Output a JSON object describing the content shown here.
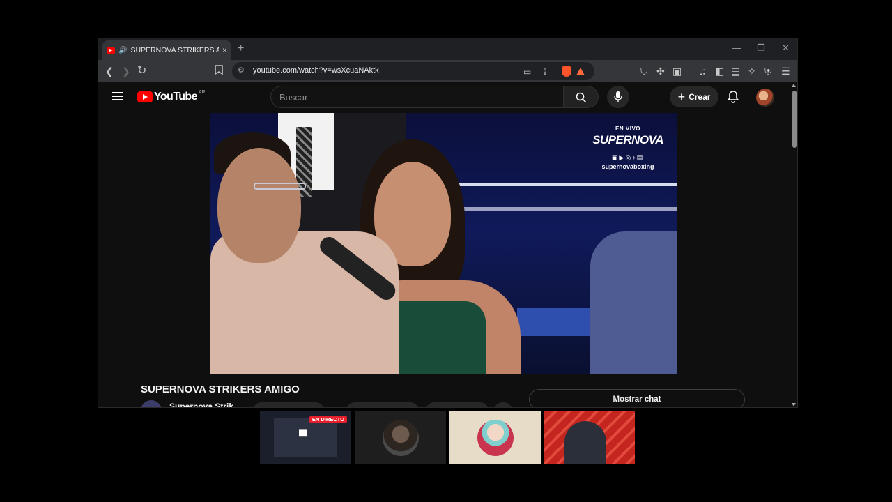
{
  "browser": {
    "tab_title": "SUPERNOVA STRIKERS AMIGO",
    "url": "youtube.com/watch?v=wsXcuaNAktk",
    "new_tab": "+",
    "tab_close": "×",
    "minimize": "—",
    "restore": "❐",
    "close": "✕"
  },
  "youtube": {
    "logo": "YouTube",
    "country": "AR",
    "search_placeholder": "Buscar",
    "create_label": "Crear"
  },
  "video": {
    "overlay_live": "EN VIVO",
    "overlay_brand": "SUPERNOVA",
    "overlay_handle": "supernovaboxing"
  },
  "details": {
    "title": "SUPERNOVA STRIKERS AMIGO",
    "channel": "Supernova Strik",
    "show_chat": "Mostrar chat"
  },
  "participants": {
    "live_badge": "EN DIRECTO"
  },
  "colors": {
    "youtube_red": "#ff0000",
    "background": "#0f0f0f",
    "browser_chrome": "#35363a"
  }
}
